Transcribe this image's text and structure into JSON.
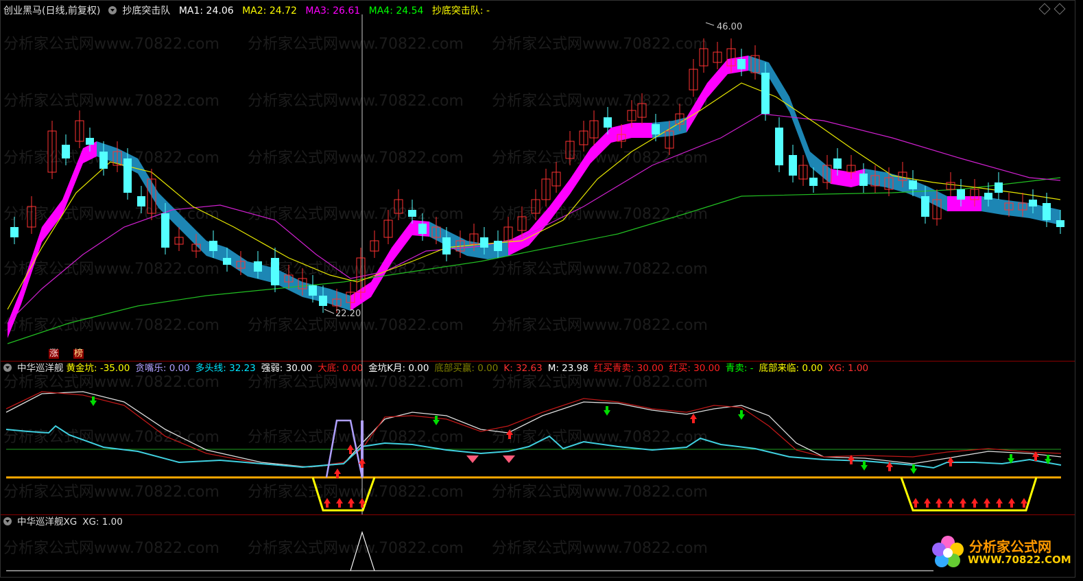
{
  "main_panel": {
    "stock_name": "创业黑马(日线,前复权)",
    "indicator_name": "抄底突击队",
    "ma1": "MA1: 24.06",
    "ma2": "MA2: 24.72",
    "ma3": "MA3: 26.61",
    "ma4": "MA4: 24.54",
    "signal": "抄底突击队: -",
    "high_label": "46.00",
    "low_label": "22.20",
    "tag_zhang": "涨",
    "tag_bang": "榜",
    "colors": {
      "ma1": "#ffffff",
      "ma2": "#ffff00",
      "ma3": "#ff00ff",
      "ma4": "#00ff00",
      "signal": "#ffff00"
    }
  },
  "sub_panel_1": {
    "name": "中华巡洋舰",
    "items": [
      {
        "text": "黄金坑: -35.00",
        "color": "#ffff00"
      },
      {
        "text": "贪嘴乐: 0.00",
        "color": "#b0a0ff"
      },
      {
        "text": "多头线: 32.23",
        "color": "#00e5ff"
      },
      {
        "text": "强弱: 30.00",
        "color": "#ffffff"
      },
      {
        "text": "大底: 0.00",
        "color": "#ff2020"
      },
      {
        "text": "金坑K月: 0.00",
        "color": "#ffffff"
      },
      {
        "text": "底部买赢: 0.00",
        "color": "#808000"
      },
      {
        "text": "K: 32.63",
        "color": "#ff3030"
      },
      {
        "text": "M: 23.98",
        "color": "#ffffff"
      },
      {
        "text": "红买青卖: 30.00",
        "color": "#ff2020"
      },
      {
        "text": "红买: 30.00",
        "color": "#ff2020"
      },
      {
        "text": "青卖: -",
        "color": "#00ff00"
      },
      {
        "text": "底部来临: 0.00",
        "color": "#ffff00"
      },
      {
        "text": "XG: 1.00",
        "color": "#ff3030"
      }
    ]
  },
  "sub_panel_2": {
    "name": "中华巡洋舰XG",
    "value": "XG: 1.00"
  },
  "watermark": {
    "text_a": "分析家公式网www.70822.com"
  },
  "logo": {
    "title": "分析家公式网",
    "url": "WWW.70822.COM"
  }
}
